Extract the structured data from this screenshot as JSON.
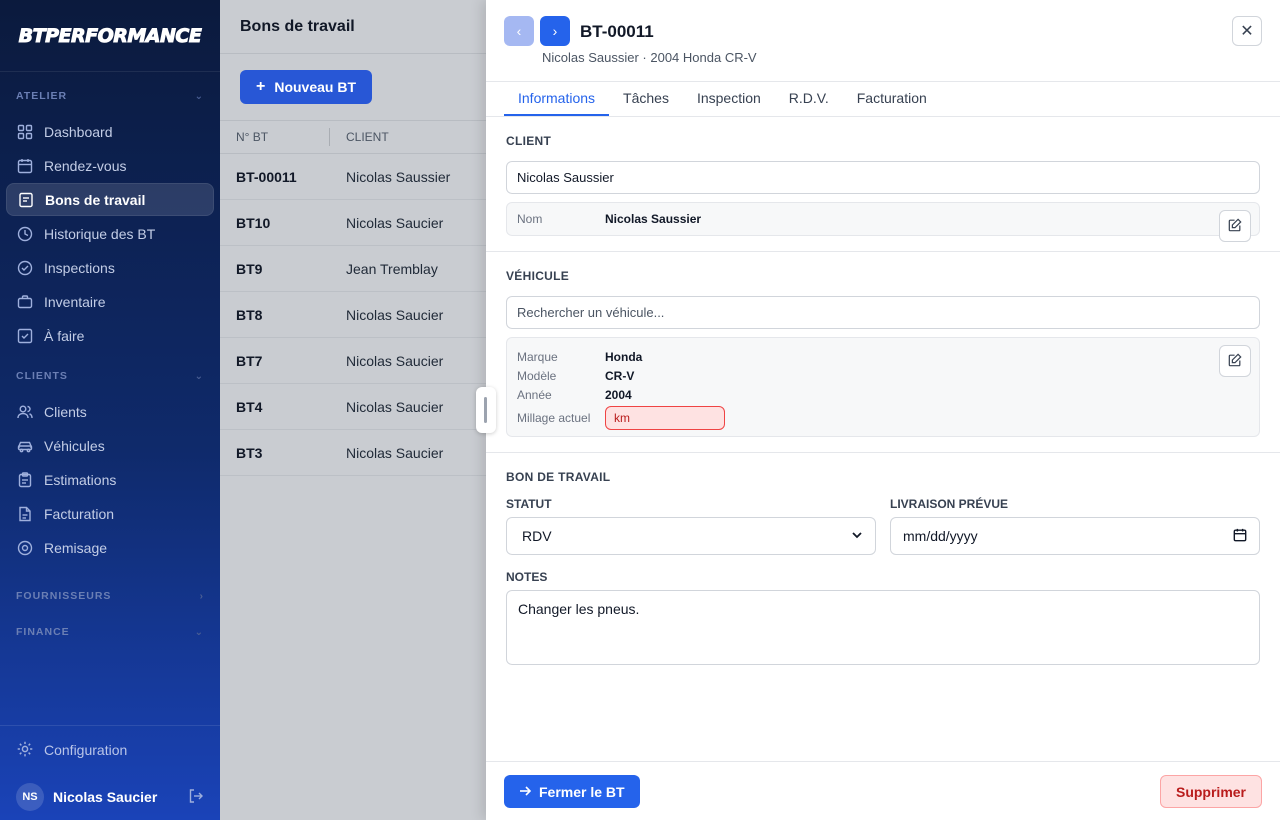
{
  "sidebar": {
    "logo": "BTPERFORMANCE",
    "sections": {
      "atelier": "ATELIER",
      "clients": "CLIENTS",
      "fournisseurs": "FOURNISSEURS",
      "finance": "FINANCE"
    },
    "atelier_items": [
      "Dashboard",
      "Rendez-vous",
      "Bons de travail",
      "Historique des BT",
      "Inspections",
      "Inventaire",
      "À faire"
    ],
    "client_items": [
      "Clients",
      "Véhicules",
      "Estimations",
      "Facturation",
      "Remisage"
    ],
    "config": "Configuration",
    "user": {
      "initials": "NS",
      "name": "Nicolas Saucier"
    }
  },
  "main": {
    "title": "Bons de travail",
    "new_button": "Nouveau BT",
    "columns": [
      "N° BT",
      "CLIENT"
    ],
    "rows": [
      {
        "id": "BT-00011",
        "client": "Nicolas Saussier"
      },
      {
        "id": "BT10",
        "client": "Nicolas Saucier"
      },
      {
        "id": "BT9",
        "client": "Jean Tremblay"
      },
      {
        "id": "BT8",
        "client": "Nicolas Saucier"
      },
      {
        "id": "BT7",
        "client": "Nicolas Saucier"
      },
      {
        "id": "BT4",
        "client": "Nicolas Saucier"
      },
      {
        "id": "BT3",
        "client": "Nicolas Saucier"
      }
    ]
  },
  "panel": {
    "title": "BT-00011",
    "subtitle": "Nicolas Saussier · 2004 Honda CR-V",
    "tabs": [
      "Informations",
      "Tâches",
      "Inspection",
      "R.D.V.",
      "Facturation"
    ],
    "client": {
      "section": "CLIENT",
      "input_value": "Nicolas Saussier",
      "name_label": "Nom",
      "name_value": "Nicolas Saussier"
    },
    "vehicle": {
      "section": "VÉHICULE",
      "search_placeholder": "Rechercher un véhicule...",
      "make_label": "Marque",
      "make": "Honda",
      "model_label": "Modèle",
      "model": "CR-V",
      "year_label": "Année",
      "year": "2004",
      "mileage_label": "Millage actuel",
      "mileage_placeholder": "km"
    },
    "work_order": {
      "section": "BON DE TRAVAIL",
      "status_label": "STATUT",
      "status_value": "RDV",
      "delivery_label": "LIVRAISON PRÉVUE",
      "delivery_placeholder": "mm/dd/yyyy",
      "notes_label": "NOTES",
      "notes_value": "Changer les pneus."
    },
    "footer": {
      "close_button": "Fermer le BT",
      "delete_button": "Supprimer"
    }
  },
  "colors": {
    "primary": "#2563eb",
    "danger": "#b91c1c",
    "sidebar_top": "#0b1a3d",
    "sidebar_bottom": "#1a43b8"
  }
}
